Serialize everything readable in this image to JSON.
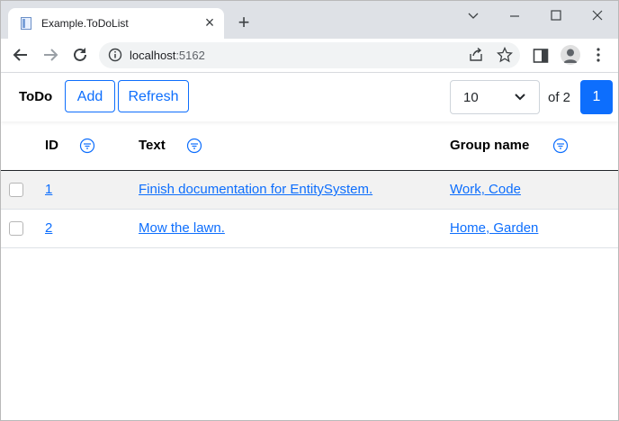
{
  "browser": {
    "tab_title": "Example.ToDoList",
    "tab_close": "×",
    "new_tab": "+",
    "url_host": "localhost",
    "url_port": ":5162"
  },
  "app": {
    "brand": "ToDo",
    "add_label": "Add",
    "refresh_label": "Refresh",
    "page_size": "10",
    "of_label": "of 2",
    "current_page": "1"
  },
  "table": {
    "columns": [
      "ID",
      "Text",
      "Group name"
    ],
    "rows": [
      {
        "id": "1",
        "text": "Finish documentation for EntitySystem.",
        "group": "Work, Code"
      },
      {
        "id": "2",
        "text": "Mow the lawn.",
        "group": "Home, Garden"
      }
    ]
  },
  "colors": {
    "accent": "#0d6efd",
    "chrome_bg": "#dee1e6",
    "stripe": "#f2f2f2"
  }
}
